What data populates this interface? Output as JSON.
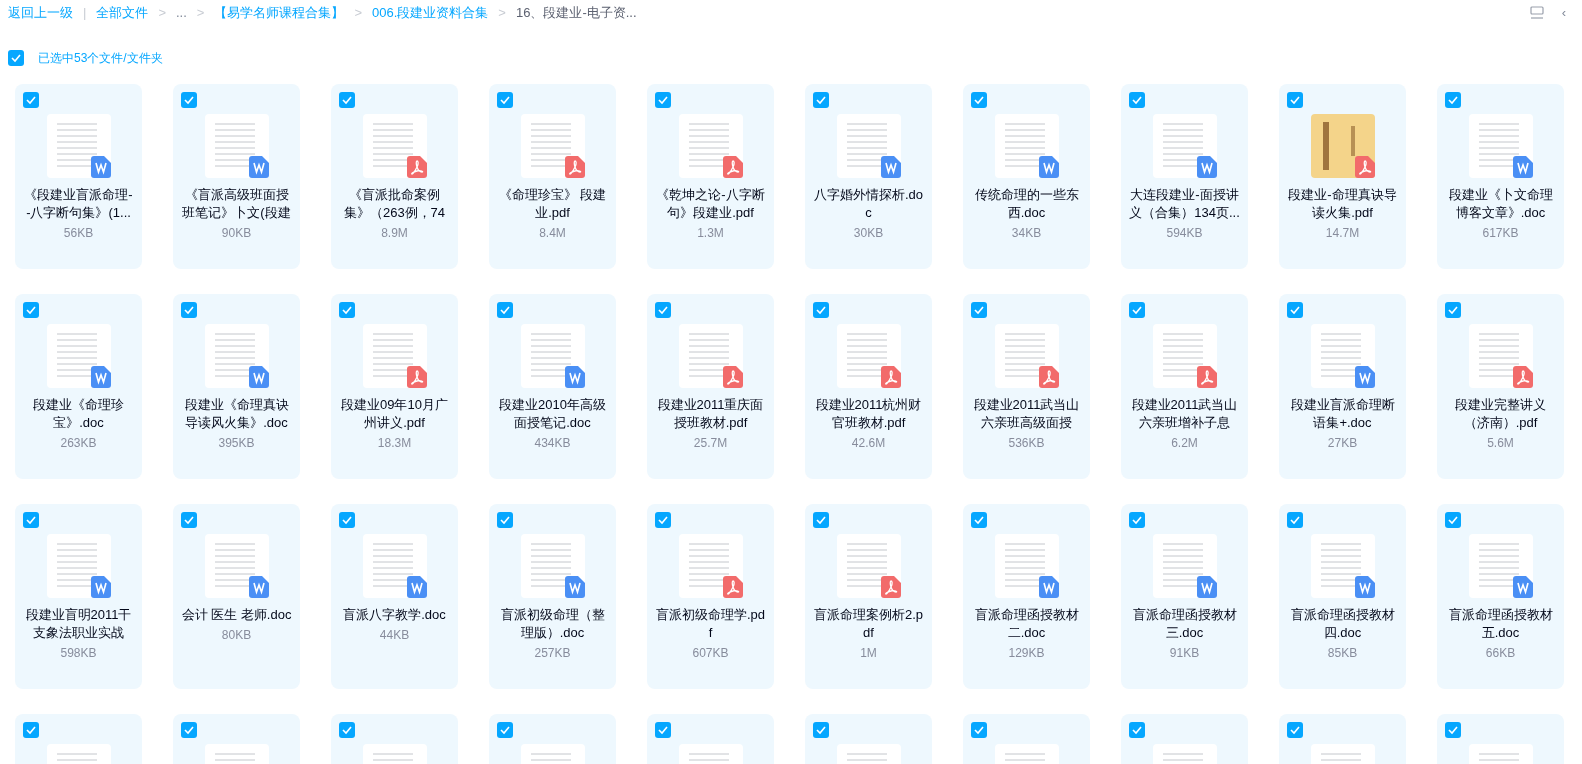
{
  "breadcrumb": [
    {
      "kind": "link",
      "text": "返回上一级"
    },
    {
      "kind": "divider",
      "text": "|"
    },
    {
      "kind": "link",
      "text": "全部文件"
    },
    {
      "kind": "sep",
      "text": ">"
    },
    {
      "kind": "more",
      "text": "..."
    },
    {
      "kind": "sep",
      "text": ">"
    },
    {
      "kind": "link",
      "text": "【易学名师课程合集】"
    },
    {
      "kind": "sep",
      "text": ">"
    },
    {
      "kind": "link",
      "text": "006.段建业资料合集"
    },
    {
      "kind": "sep",
      "text": ">"
    },
    {
      "kind": "current",
      "text": "16、段建业-电子资..."
    }
  ],
  "toolbar": {
    "collapse_arrow": "‹"
  },
  "selection": {
    "checked": true,
    "label": "已选中53个文件/文件夹"
  },
  "files": [
    {
      "checked": true,
      "kind": "doc",
      "name_lines": [
        "《段建业盲派命理-",
        "-八字断句集》(1..."
      ],
      "size": "56KB"
    },
    {
      "checked": true,
      "kind": "doc",
      "name_lines": [
        "《盲派高级班面授",
        "班笔记》卜文(段建"
      ],
      "size": "90KB"
    },
    {
      "checked": true,
      "kind": "pdf",
      "name_lines": [
        "《盲派批命案例",
        "集》（263例，74"
      ],
      "size": "8.9M"
    },
    {
      "checked": true,
      "kind": "pdf",
      "name_lines": [
        "《命理珍宝》 段建",
        "业.pdf"
      ],
      "size": "8.4M"
    },
    {
      "checked": true,
      "kind": "pdf",
      "name_lines": [
        "《乾坤之论-八字断",
        "句》段建业.pdf"
      ],
      "size": "1.3M"
    },
    {
      "checked": true,
      "kind": "doc",
      "name_lines": [
        "八字婚外情探析.do",
        "c"
      ],
      "size": "30KB"
    },
    {
      "checked": true,
      "kind": "doc",
      "name_lines": [
        "传统命理的一些东",
        "西.doc"
      ],
      "size": "34KB"
    },
    {
      "checked": true,
      "kind": "doc",
      "name_lines": [
        "大连段建业-面授讲",
        "义（合集）134页..."
      ],
      "size": "594KB"
    },
    {
      "checked": true,
      "kind": "pdf_cover",
      "name_lines": [
        "段建业-命理真诀导",
        "读火集.pdf"
      ],
      "size": "14.7M"
    },
    {
      "checked": true,
      "kind": "doc",
      "name_lines": [
        "段建业《卜文命理",
        "博客文章》.doc"
      ],
      "size": "617KB"
    },
    {
      "checked": true,
      "kind": "doc",
      "name_lines": [
        "段建业《命理珍",
        "宝》.doc"
      ],
      "size": "263KB"
    },
    {
      "checked": true,
      "kind": "doc",
      "name_lines": [
        "段建业《命理真诀",
        "导读风火集》.doc"
      ],
      "size": "395KB"
    },
    {
      "checked": true,
      "kind": "pdf",
      "name_lines": [
        "段建业09年10月广",
        "州讲义.pdf"
      ],
      "size": "18.3M"
    },
    {
      "checked": true,
      "kind": "doc",
      "name_lines": [
        "段建业2010年高级",
        "面授笔记.doc"
      ],
      "size": "434KB"
    },
    {
      "checked": true,
      "kind": "pdf",
      "name_lines": [
        "段建业2011重庆面",
        "授班教材.pdf"
      ],
      "size": "25.7M"
    },
    {
      "checked": true,
      "kind": "pdf",
      "name_lines": [
        "段建业2011杭州财",
        "官班教材.pdf"
      ],
      "size": "42.6M"
    },
    {
      "checked": true,
      "kind": "pdf",
      "name_lines": [
        "段建业2011武当山",
        "六亲班高级面授"
      ],
      "size": "536KB"
    },
    {
      "checked": true,
      "kind": "pdf",
      "name_lines": [
        "段建业2011武当山",
        "六亲班增补子息"
      ],
      "size": "6.2M"
    },
    {
      "checked": true,
      "kind": "doc",
      "name_lines": [
        "段建业盲派命理断",
        "语集+.doc"
      ],
      "size": "27KB"
    },
    {
      "checked": true,
      "kind": "pdf",
      "name_lines": [
        "段建业完整讲义",
        "（济南）.pdf"
      ],
      "size": "5.6M"
    },
    {
      "checked": true,
      "kind": "doc",
      "name_lines": [
        "段建业盲明2011干",
        "支象法职业实战"
      ],
      "size": "598KB"
    },
    {
      "checked": true,
      "kind": "doc",
      "name_lines": [
        "会计 医生 老师.doc"
      ],
      "size": "80KB"
    },
    {
      "checked": true,
      "kind": "doc",
      "name_lines": [
        "盲派八字教学.doc"
      ],
      "size": "44KB"
    },
    {
      "checked": true,
      "kind": "doc",
      "name_lines": [
        "盲派初级命理（整",
        "理版）.doc"
      ],
      "size": "257KB"
    },
    {
      "checked": true,
      "kind": "pdf",
      "name_lines": [
        "盲派初级命理学.pd",
        "f"
      ],
      "size": "607KB"
    },
    {
      "checked": true,
      "kind": "pdf",
      "name_lines": [
        "盲派命理案例析2.p",
        "df"
      ],
      "size": "1M"
    },
    {
      "checked": true,
      "kind": "doc",
      "name_lines": [
        "盲派命理函授教材",
        "二.doc"
      ],
      "size": "129KB"
    },
    {
      "checked": true,
      "kind": "doc",
      "name_lines": [
        "盲派命理函授教材",
        "三.doc"
      ],
      "size": "91KB"
    },
    {
      "checked": true,
      "kind": "doc",
      "name_lines": [
        "盲派命理函授教材",
        "四.doc"
      ],
      "size": "85KB"
    },
    {
      "checked": true,
      "kind": "doc",
      "name_lines": [
        "盲派命理函授教材",
        "五.doc"
      ],
      "size": "66KB"
    },
    {
      "checked": true
    },
    {
      "checked": true
    },
    {
      "checked": true
    },
    {
      "checked": true
    },
    {
      "checked": true
    },
    {
      "checked": true
    },
    {
      "checked": true
    },
    {
      "checked": true
    },
    {
      "checked": true
    },
    {
      "checked": true
    }
  ]
}
